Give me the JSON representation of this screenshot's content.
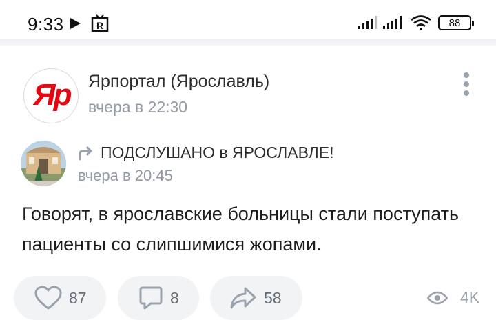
{
  "status_bar": {
    "time": "9:33",
    "tv_icon_letter": "R",
    "battery": "88",
    "icons": [
      "play-icon",
      "tv-icon",
      "signal-icon",
      "signal-icon",
      "wifi-icon",
      "battery-icon"
    ]
  },
  "post": {
    "author": "Ярпортал (Ярославль)",
    "avatar_text": "Яр",
    "time": "вчера в 22:30",
    "repost": {
      "source": "ПОДСЛУШАНО в ЯРОСЛАВЛЕ!",
      "time": "вчера в 20:45"
    },
    "text": "Говорят, в ярославские больницы стали поступать пациенты со слипшимися жопами."
  },
  "actions": {
    "likes": "87",
    "comments": "8",
    "shares": "58",
    "views": "4K"
  },
  "colors": {
    "logo_red": "#e30613",
    "icon_gray": "#99a2ad",
    "muted_text": "#939aa3",
    "button_bg": "#f2f3f5"
  }
}
